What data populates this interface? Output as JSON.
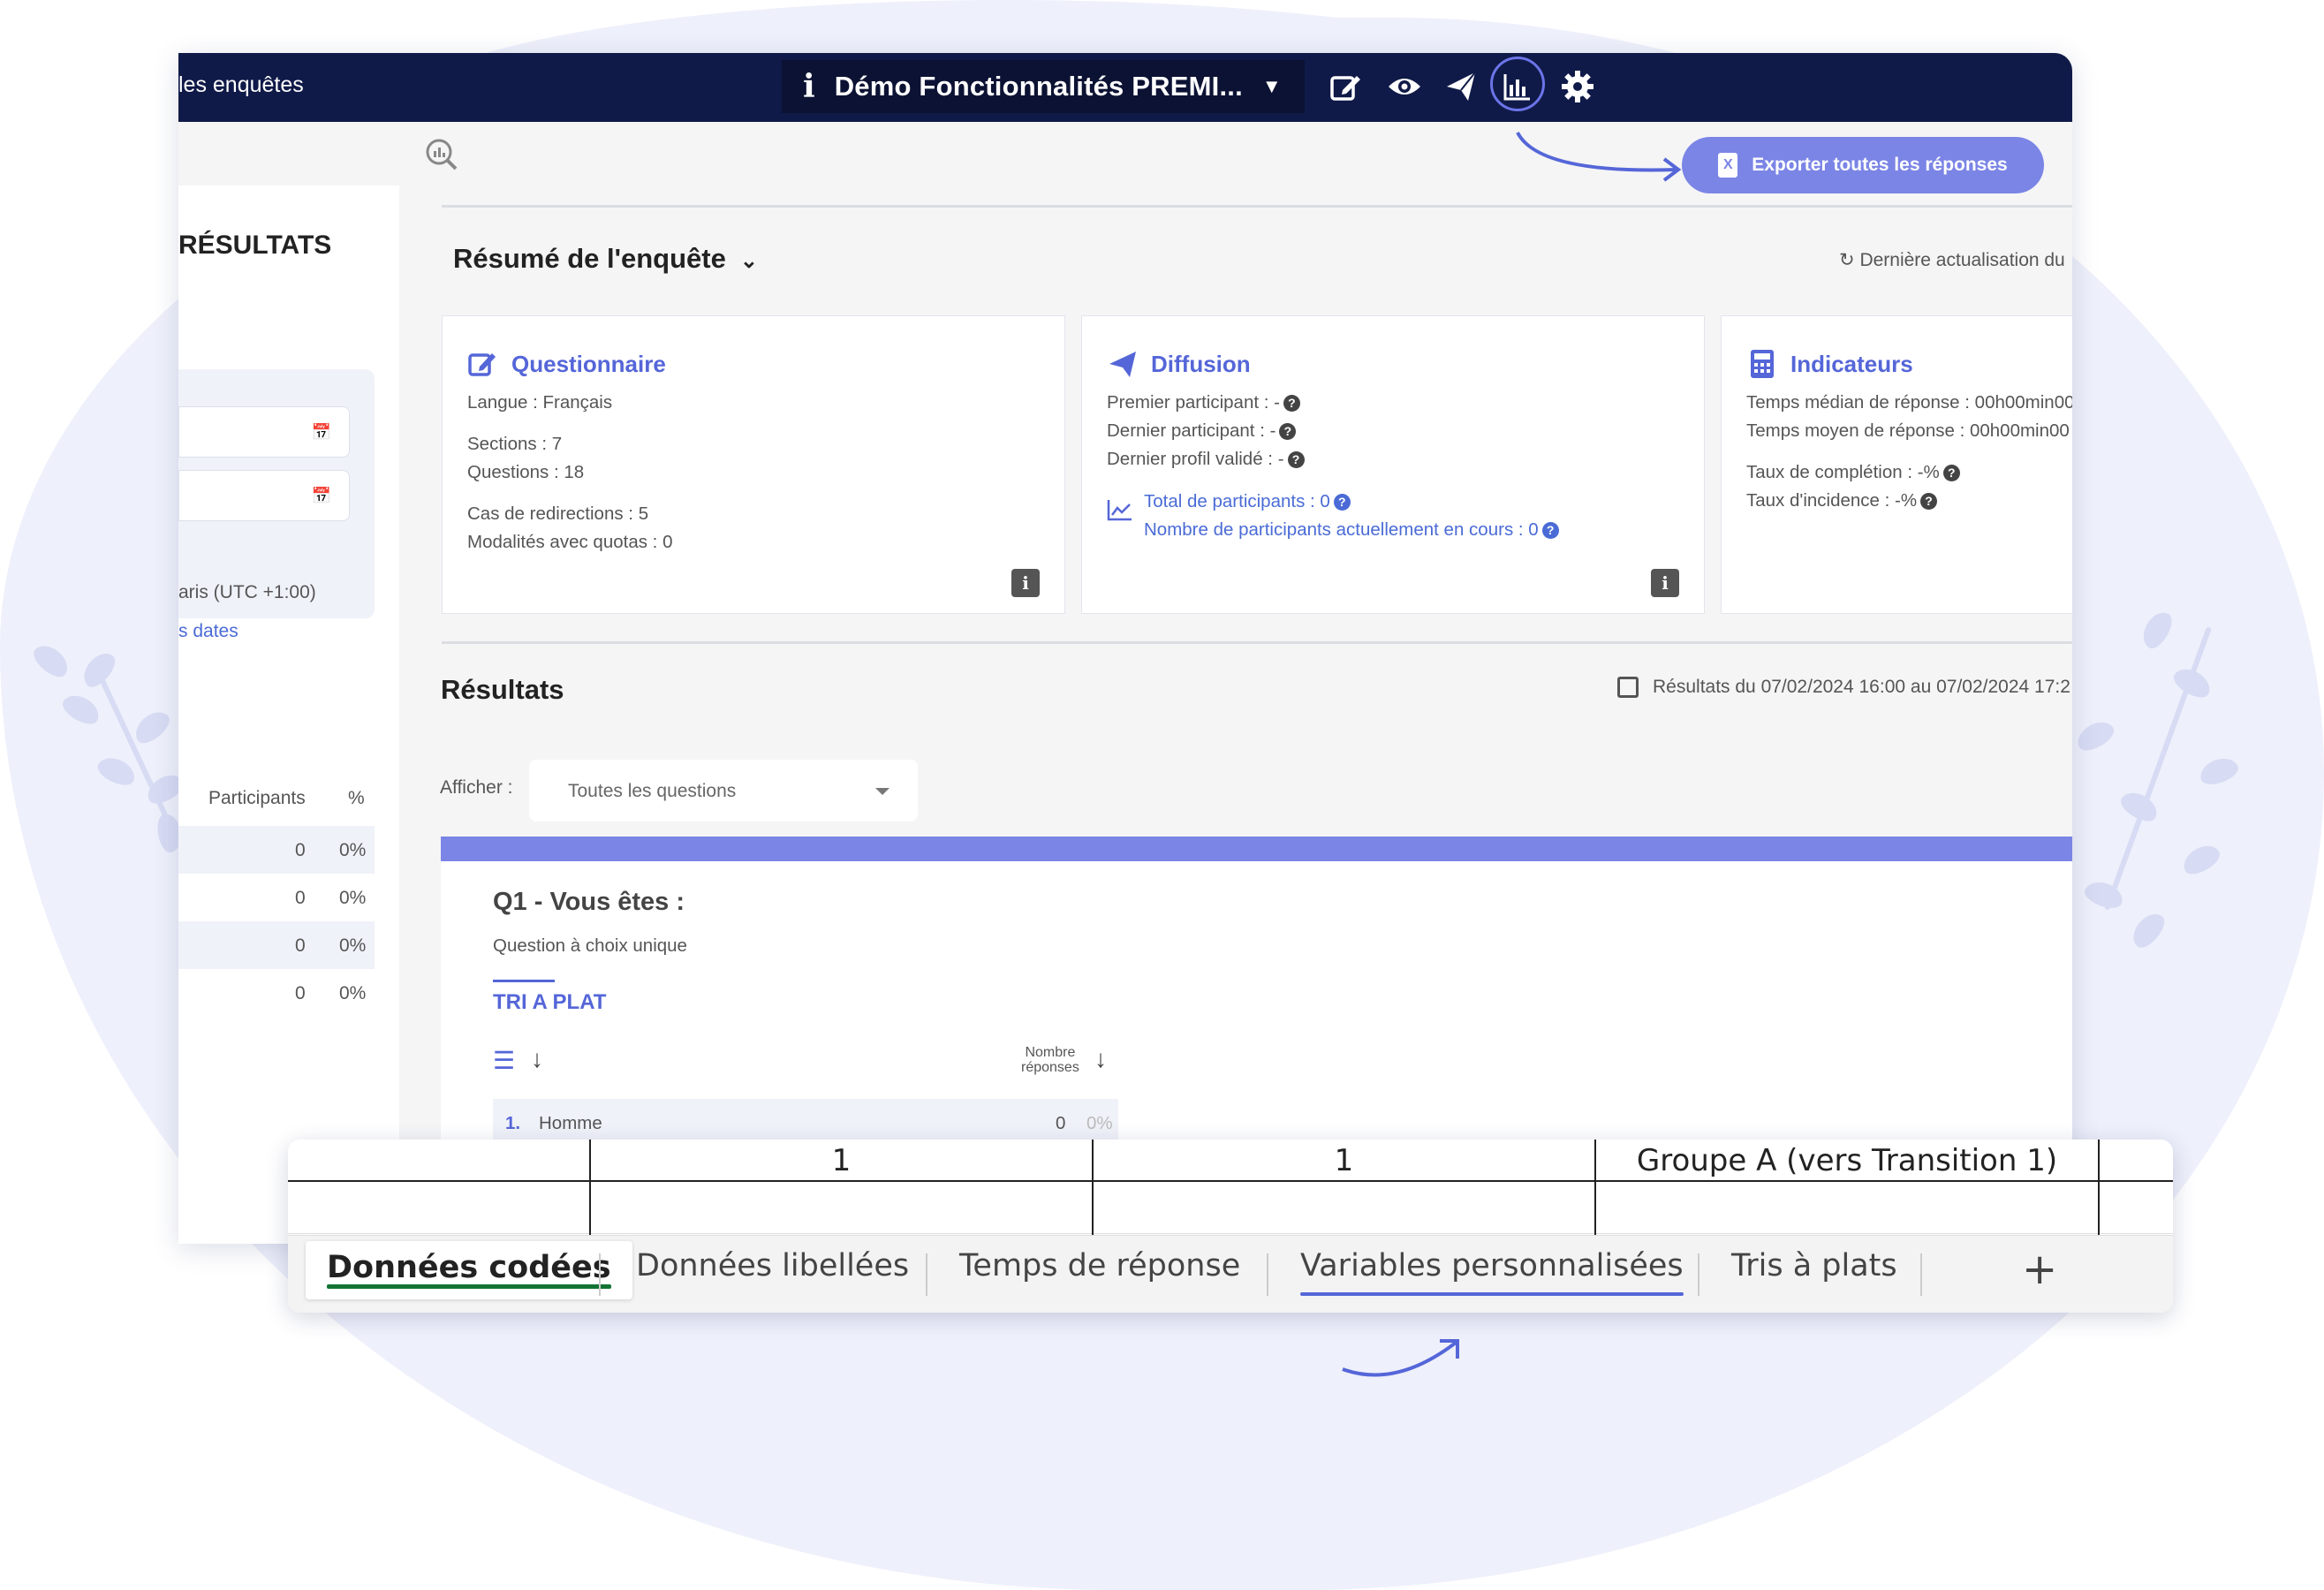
{
  "topbar": {
    "back_link": "les enquêtes",
    "survey_title": "Démo Fonctionnalités PREMI...",
    "icons": [
      "info-icon",
      "chevron-down-icon",
      "edit-icon",
      "eye-icon",
      "send-icon",
      "chart-icon",
      "gear-icon"
    ]
  },
  "export_button": {
    "label": "Exporter toutes les réponses",
    "icon": "excel-file-icon"
  },
  "sidebar": {
    "title": "RÉSULTATS",
    "timezone": "aris (UTC +1:00)",
    "clear_dates": "s dates",
    "table": {
      "headers": [
        "Participants",
        "%"
      ],
      "rows": [
        [
          "0",
          "0%"
        ],
        [
          "0",
          "0%"
        ],
        [
          "0",
          "0%"
        ],
        [
          "0",
          "0%"
        ]
      ]
    }
  },
  "summary": {
    "title": "Résumé de l'enquête",
    "last_update": "Dernière actualisation du",
    "questionnaire": {
      "title": "Questionnaire",
      "language": "Langue : Français",
      "sections": "Sections : 7",
      "questions": "Questions : 18",
      "redirections": "Cas de redirections : 5",
      "quotas": "Modalités avec quotas : 0"
    },
    "diffusion": {
      "title": "Diffusion",
      "first": "Premier participant : -",
      "last": "Dernier participant : -",
      "last_valid": "Dernier profil validé : -",
      "total": "Total de participants : 0",
      "in_progress": "Nombre de participants actuellement en cours : 0"
    },
    "indicateurs": {
      "title": "Indicateurs",
      "median": "Temps médian de réponse : 00h00min00",
      "mean": "Temps moyen de réponse : 00h00min00",
      "completion": "Taux de complétion : -%",
      "incidence": "Taux d'incidence : -%"
    }
  },
  "results": {
    "title": "Résultats",
    "range": "Résultats du 07/02/2024 16:00 au 07/02/2024 17:2",
    "afficher_label": "Afficher :",
    "filter_value": "Toutes les questions",
    "question": {
      "title": "Q1 - Vous êtes :",
      "type": "Question à choix unique",
      "tab": "TRI A PLAT",
      "col_header_line1": "Nombre",
      "col_header_line2": "réponses",
      "answer": {
        "index": "1.",
        "label": "Homme",
        "count": "0",
        "pct": "0%"
      }
    }
  },
  "spreadsheet": {
    "cells": [
      "1",
      "1",
      "Groupe A (vers Transition 1)"
    ],
    "tabs": [
      "Données codées",
      "Données libellées",
      "Temps de réponse",
      "Variables personnalisées",
      "Tris à plats"
    ],
    "active_tab": "Données codées",
    "add_tab": "+"
  },
  "colors": {
    "navy": "#101a48",
    "accent": "#7b85e6",
    "link": "#4a6bd6",
    "sheet_active": "#137333"
  }
}
